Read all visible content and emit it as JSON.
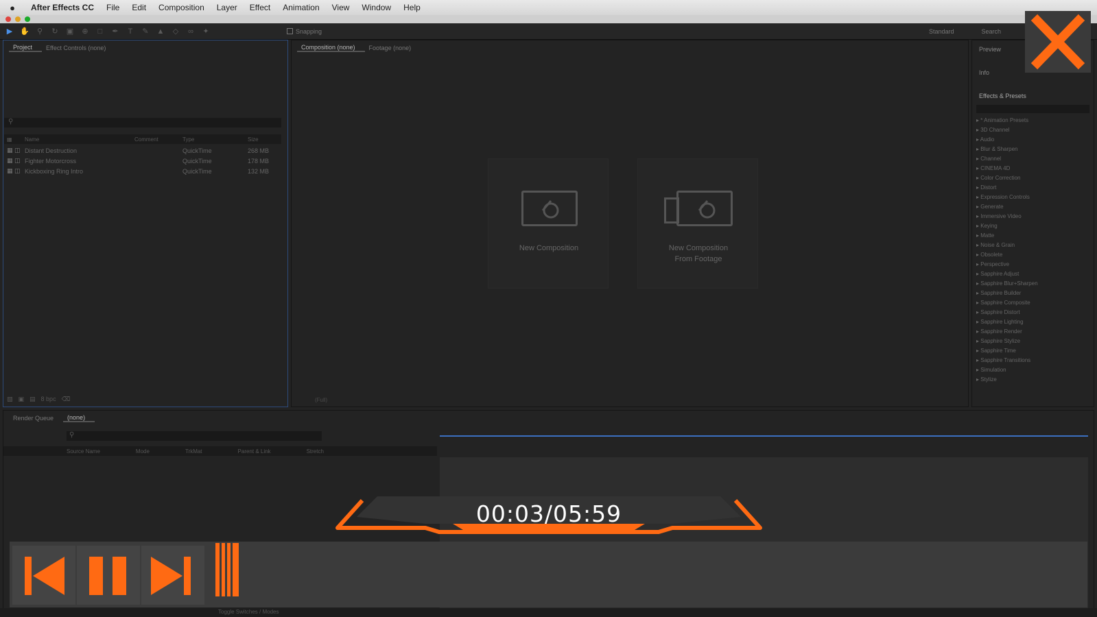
{
  "menu": {
    "apple": "",
    "items": [
      "After Effects CC",
      "File",
      "Edit",
      "Composition",
      "Layer",
      "Effect",
      "Animation",
      "View",
      "Window",
      "Help"
    ]
  },
  "toolbar": {
    "snapping_label": "Snapping",
    "workspace_label": "Standard",
    "search_label": "Search"
  },
  "project_panel": {
    "tabs": [
      "Project",
      "Effect Controls (none)"
    ],
    "rows": [
      {
        "name": "Distant Destruction",
        "type": "QuickTime",
        "size": "268 MB"
      },
      {
        "name": "Fighter Motorcross",
        "type": "QuickTime",
        "size": "178 MB"
      },
      {
        "name": "Kickboxing Ring Intro",
        "type": "QuickTime",
        "size": "132 MB"
      }
    ],
    "columns": [
      "Name",
      "Comment",
      "Type",
      "Size"
    ],
    "footer_bpc": "8 bpc"
  },
  "viewer": {
    "tabs": [
      "Composition (none)",
      "Footage (none)"
    ],
    "new_comp": "New Composition",
    "new_comp_footage_line1": "New Composition",
    "new_comp_footage_line2": "From Footage",
    "zoom": "(Full)"
  },
  "right_panel": {
    "preview": "Preview",
    "info": "Info",
    "effects_title": "Effects & Presets",
    "effects": [
      "* Animation Presets",
      "3D Channel",
      "Audio",
      "Blur & Sharpen",
      "Channel",
      "CINEMA 4D",
      "Color Correction",
      "Distort",
      "Expression Controls",
      "Generate",
      "Immersive Video",
      "Keying",
      "Matte",
      "Noise & Grain",
      "Obsolete",
      "Perspective",
      "Sapphire Adjust",
      "Sapphire Blur+Sharpen",
      "Sapphire Builder",
      "Sapphire Composite",
      "Sapphire Distort",
      "Sapphire Lighting",
      "Sapphire Render",
      "Sapphire Stylize",
      "Sapphire Time",
      "Sapphire Transitions",
      "Simulation",
      "Stylize"
    ]
  },
  "timeline": {
    "tabs": [
      "Render Queue",
      "(none)"
    ],
    "columns": [
      "Source Name",
      "Mode",
      "TrkMat",
      "Parent & Link",
      "Stretch"
    ],
    "toggle_label": "Toggle Switches / Modes"
  },
  "player": {
    "time": "00:03/05:59",
    "accent": "#ff6a13"
  },
  "colors": {
    "accent": "#ff6a13",
    "selection": "#3b6fc0"
  }
}
